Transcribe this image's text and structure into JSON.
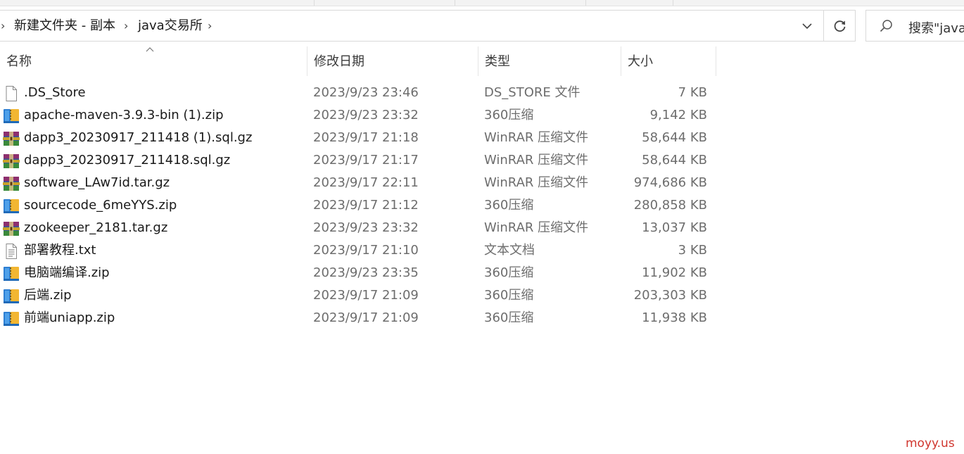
{
  "address": {
    "crumbs": [
      "新建文件夹 - 副本",
      "java交易所"
    ]
  },
  "search": {
    "placeholder": "搜索\"java"
  },
  "columns": {
    "name": "名称",
    "date": "修改日期",
    "type": "类型",
    "size": "大小"
  },
  "files": [
    {
      "name": ".DS_Store",
      "date": "2023/9/23 23:46",
      "type": "DS_STORE 文件",
      "size": "7 KB",
      "icon": "file-icon"
    },
    {
      "name": "apache-maven-3.9.3-bin (1).zip",
      "date": "2023/9/23 23:32",
      "type": "360压缩",
      "size": "9,142 KB",
      "icon": "zip-icon"
    },
    {
      "name": "dapp3_20230917_211418 (1).sql.gz",
      "date": "2023/9/17 21:18",
      "type": "WinRAR 压缩文件",
      "size": "58,644 KB",
      "icon": "rar-icon"
    },
    {
      "name": "dapp3_20230917_211418.sql.gz",
      "date": "2023/9/17 21:17",
      "type": "WinRAR 压缩文件",
      "size": "58,644 KB",
      "icon": "rar-icon"
    },
    {
      "name": "software_LAw7id.tar.gz",
      "date": "2023/9/17 22:11",
      "type": "WinRAR 压缩文件",
      "size": "974,686 KB",
      "icon": "rar-icon"
    },
    {
      "name": "sourcecode_6meYYS.zip",
      "date": "2023/9/17 21:12",
      "type": "360压缩",
      "size": "280,858 KB",
      "icon": "zip-icon"
    },
    {
      "name": "zookeeper_2181.tar.gz",
      "date": "2023/9/23 23:32",
      "type": "WinRAR 压缩文件",
      "size": "13,037 KB",
      "icon": "rar-icon"
    },
    {
      "name": "部署教程.txt",
      "date": "2023/9/17 21:10",
      "type": "文本文档",
      "size": "3 KB",
      "icon": "text-file-icon"
    },
    {
      "name": "电脑端编译.zip",
      "date": "2023/9/23 23:35",
      "type": "360压缩",
      "size": "11,902 KB",
      "icon": "zip-icon"
    },
    {
      "name": "后端.zip",
      "date": "2023/9/17 21:09",
      "type": "360压缩",
      "size": "203,303 KB",
      "icon": "zip-icon"
    },
    {
      "name": "前端uniapp.zip",
      "date": "2023/9/17 21:09",
      "type": "360压缩",
      "size": "11,938 KB",
      "icon": "zip-icon"
    }
  ],
  "watermark": "moyy.us",
  "colors": {
    "watermark": "#d0362e",
    "secondary_text": "#6d6d6d",
    "border": "#d9d9d9"
  }
}
